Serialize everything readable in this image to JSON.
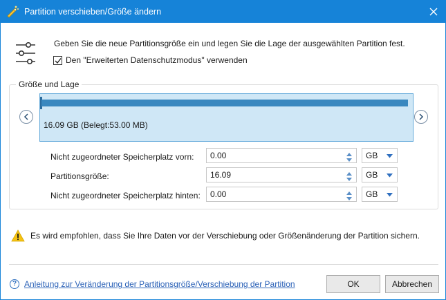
{
  "window": {
    "title": "Partition verschieben/Größe ändern",
    "accent_color": "#1683d8"
  },
  "intro": {
    "description": "Geben Sie die neue Partitionsgröße ein und legen Sie die Lage der ausgewählten Partition fest.",
    "checkbox_label": "Den \"Erweiterten Datenschutzmodus\" verwenden",
    "checkbox_checked": true
  },
  "group": {
    "label": "Größe und Lage",
    "partition_info": "16.09 GB (Belegt:53.00 MB)",
    "partition_color": "#cfe7f6",
    "used_bar_color": "#3a88bf"
  },
  "fields": [
    {
      "label": "Nicht zugeordneter Speicherplatz vorn:",
      "value": "0.00",
      "unit": "GB"
    },
    {
      "label": "Partitionsgröße:",
      "value": "16.09",
      "unit": "GB"
    },
    {
      "label": "Nicht zugeordneter Speicherplatz hinten:",
      "value": "0.00",
      "unit": "GB"
    }
  ],
  "warning": {
    "icon": "warning-triangle-icon",
    "text": "Es wird empfohlen, dass Sie Ihre Daten vor der Verschiebung oder Größenänderung der Partition sichern."
  },
  "footer": {
    "help_link": "Anleitung zur Veränderung der Partitionsgröße/Verschiebung der Partition",
    "ok_label": "OK",
    "cancel_label": "Abbrechen"
  }
}
